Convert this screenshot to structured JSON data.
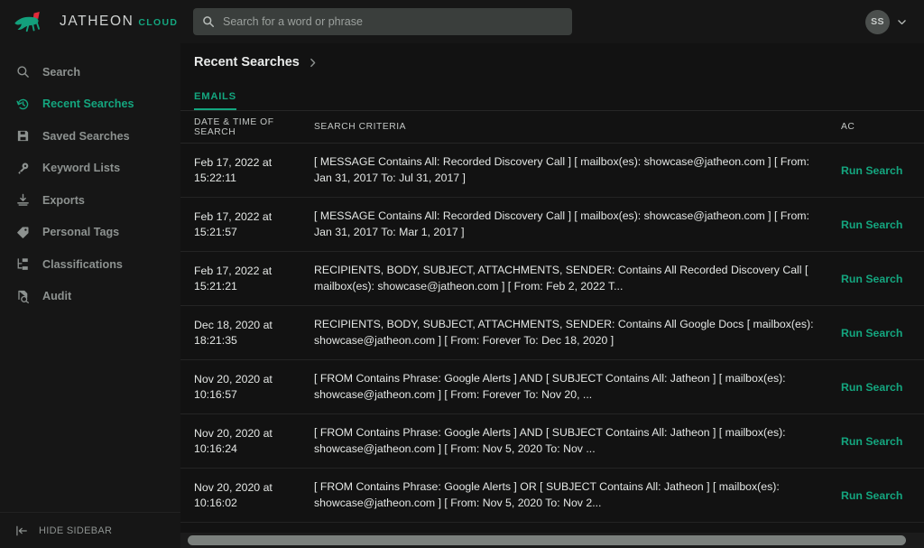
{
  "brand": {
    "name": "JATHEON",
    "suffix": "CLOUD",
    "logo_icon": "fox-logo-icon",
    "teal": "#14a67f",
    "red": "#e02b3a"
  },
  "sidebar": {
    "items": [
      {
        "label": "Search",
        "icon": "search-icon",
        "active": false
      },
      {
        "label": "Recent Searches",
        "icon": "clock-rewind-icon",
        "active": true
      },
      {
        "label": "Saved Searches",
        "icon": "floppy-disk-icon",
        "active": false
      },
      {
        "label": "Keyword Lists",
        "icon": "key-icon",
        "active": false
      },
      {
        "label": "Exports",
        "icon": "download-tray-icon",
        "active": false
      },
      {
        "label": "Personal Tags",
        "icon": "tag-icon",
        "active": false
      },
      {
        "label": "Classifications",
        "icon": "hierarchy-icon",
        "active": false
      },
      {
        "label": "Audit",
        "icon": "document-search-icon",
        "active": false
      }
    ],
    "hide_sidebar_label": "HIDE SIDEBAR",
    "hide_sidebar_icon": "collapse-left-icon"
  },
  "topbar": {
    "search_placeholder": "Search for a word or phrase",
    "search_value": "",
    "search_icon": "search-icon",
    "avatar_initials": "SS",
    "chevron_icon": "chevron-down-icon"
  },
  "breadcrumb": {
    "title": "Recent Searches",
    "chevron_icon": "chevron-right-icon"
  },
  "tabs": [
    {
      "label": "EMAILS",
      "active": true
    }
  ],
  "table": {
    "columns": {
      "date": "DATE & TIME OF SEARCH",
      "criteria": "SEARCH CRITERIA",
      "actions": "AC"
    },
    "action_label": "Run Search",
    "rows": [
      {
        "date": "Feb 17, 2022 at 15:22:11",
        "criteria": "[ MESSAGE Contains All: Recorded Discovery Call ] [ mailbox(es): showcase@jatheon.com ] [ From: Jan 31, 2017 To: Jul 31, 2017 ]"
      },
      {
        "date": "Feb 17, 2022 at 15:21:57",
        "criteria": "[ MESSAGE Contains All: Recorded Discovery Call ] [ mailbox(es): showcase@jatheon.com ] [ From: Jan 31, 2017 To: Mar 1, 2017 ]"
      },
      {
        "date": "Feb 17, 2022 at 15:21:21",
        "criteria": "RECIPIENTS, BODY, SUBJECT, ATTACHMENTS, SENDER: Contains All Recorded Discovery Call [ mailbox(es): showcase@jatheon.com ] [ From: Feb 2, 2022 T..."
      },
      {
        "date": "Dec 18, 2020 at 18:21:35",
        "criteria": "RECIPIENTS, BODY, SUBJECT, ATTACHMENTS, SENDER: Contains All Google Docs [ mailbox(es): showcase@jatheon.com ] [ From: Forever To: Dec 18, 2020 ]"
      },
      {
        "date": "Nov 20, 2020 at 10:16:57",
        "criteria": "[ FROM Contains Phrase: Google Alerts ] AND [ SUBJECT Contains All: Jatheon ] [ mailbox(es): showcase@jatheon.com ] [ From: Forever To: Nov 20, ..."
      },
      {
        "date": "Nov 20, 2020 at 10:16:24",
        "criteria": "[ FROM Contains Phrase: Google Alerts ] AND [ SUBJECT Contains All: Jatheon ] [ mailbox(es): showcase@jatheon.com ] [ From: Nov 5, 2020 To: Nov ..."
      },
      {
        "date": "Nov 20, 2020 at 10:16:02",
        "criteria": "[ FROM Contains Phrase: Google Alerts ] OR [ SUBJECT Contains All: Jatheon ] [ mailbox(es): showcase@jatheon.com ] [ From: Nov 5, 2020 To: Nov 2..."
      }
    ]
  }
}
